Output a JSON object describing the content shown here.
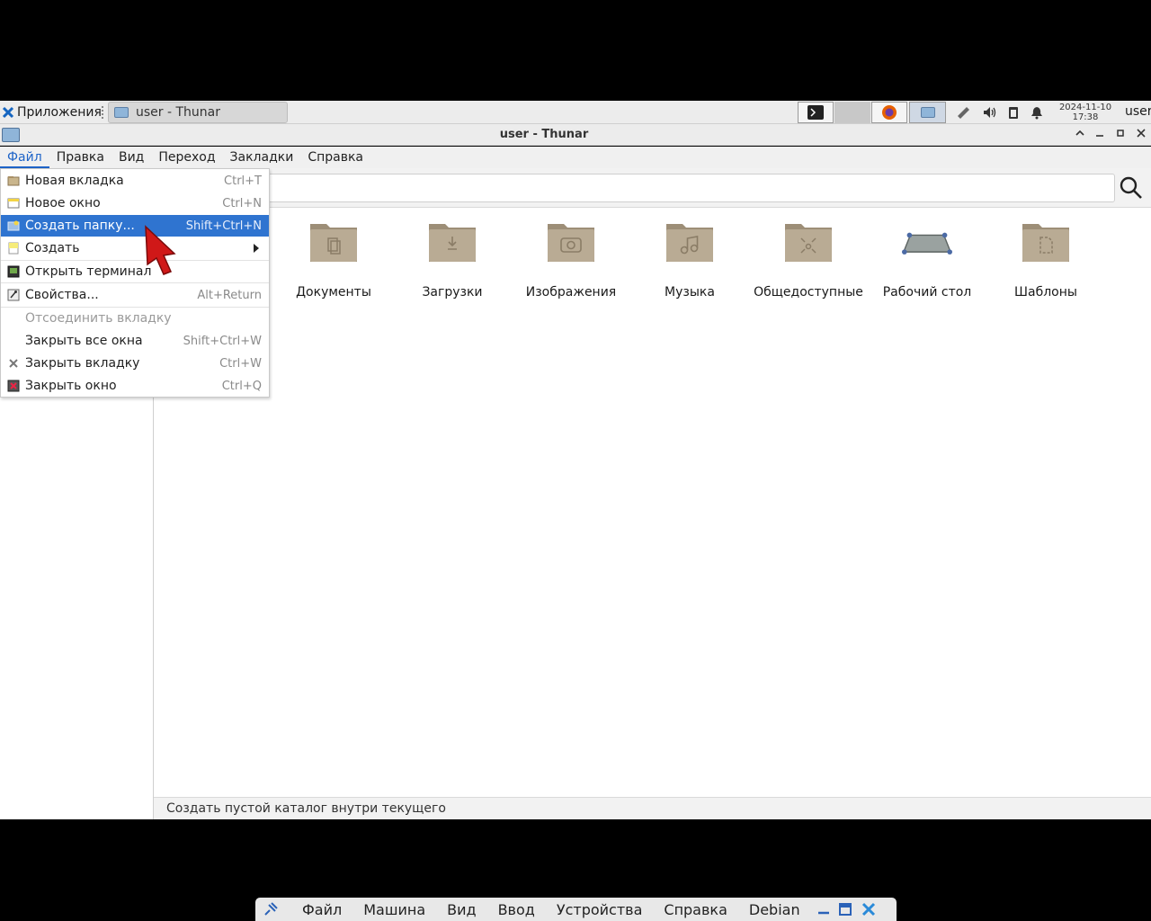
{
  "panel": {
    "apps_label": "Приложения",
    "task_label": "user - Thunar",
    "clock_date": "2024-11-10",
    "clock_time": "17:38",
    "user": "user"
  },
  "window": {
    "title": "user - Thunar"
  },
  "menubar": [
    "Файл",
    "Правка",
    "Вид",
    "Переход",
    "Закладки",
    "Справка"
  ],
  "file_menu": {
    "items": [
      {
        "label": "Новая вкладка",
        "accel": "Ctrl+T"
      },
      {
        "label": "Новое окно",
        "accel": "Ctrl+N"
      },
      {
        "label": "Создать папку...",
        "accel": "Shift+Ctrl+N"
      },
      {
        "label": "Создать",
        "accel": ""
      },
      {
        "label": "Открыть терминал",
        "accel": ""
      },
      {
        "label": "Свойства...",
        "accel": "Alt+Return"
      },
      {
        "label": "Отсоединить вкладку",
        "accel": ""
      },
      {
        "label": "Закрыть все окна",
        "accel": "Shift+Ctrl+W"
      },
      {
        "label": "Закрыть вкладку",
        "accel": "Ctrl+W"
      },
      {
        "label": "Закрыть окно",
        "accel": "Ctrl+Q"
      }
    ]
  },
  "folders": [
    {
      "name": "Документы"
    },
    {
      "name": "Загрузки"
    },
    {
      "name": "Изображения"
    },
    {
      "name": "Музыка"
    },
    {
      "name": "Общедоступные"
    },
    {
      "name": "Рабочий стол"
    },
    {
      "name": "Шаблоны"
    }
  ],
  "statusbar": {
    "text": "Создать пустой каталог внутри текущего"
  },
  "vbox_menu": [
    "Файл",
    "Машина",
    "Вид",
    "Ввод",
    "Устройства",
    "Справка",
    "Debian"
  ],
  "colors": {
    "highlight": "#2f74d0",
    "folder": "#b5a68f",
    "active_menu": "#1e64c8"
  }
}
